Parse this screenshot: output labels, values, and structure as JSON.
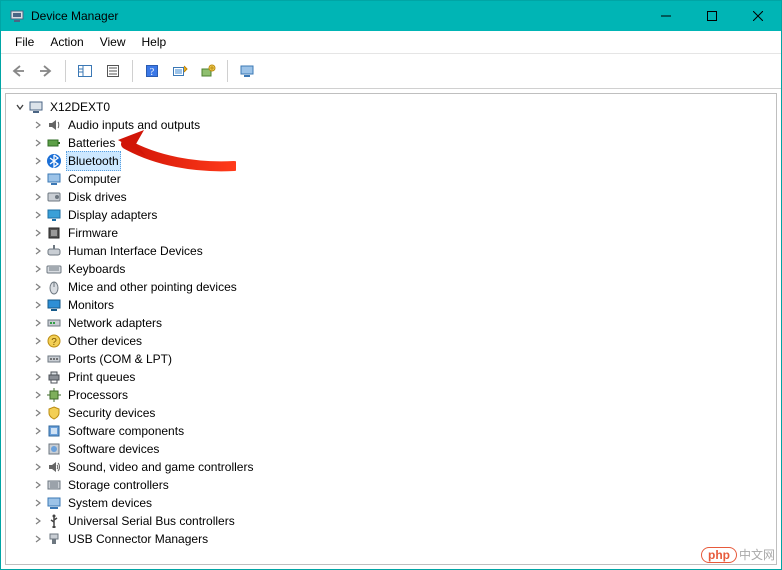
{
  "window": {
    "title": "Device Manager"
  },
  "menubar": {
    "items": [
      "File",
      "Action",
      "View",
      "Help"
    ]
  },
  "tree": {
    "root": {
      "label": "X12DEXT0",
      "expanded": true
    },
    "children": [
      {
        "label": "Audio inputs and outputs",
        "icon": "audio-icon"
      },
      {
        "label": "Batteries",
        "icon": "battery-icon"
      },
      {
        "label": "Bluetooth",
        "icon": "bluetooth-icon",
        "selected": true
      },
      {
        "label": "Computer",
        "icon": "computer-icon"
      },
      {
        "label": "Disk drives",
        "icon": "disk-icon"
      },
      {
        "label": "Display adapters",
        "icon": "display-icon"
      },
      {
        "label": "Firmware",
        "icon": "firmware-icon"
      },
      {
        "label": "Human Interface Devices",
        "icon": "hid-icon"
      },
      {
        "label": "Keyboards",
        "icon": "keyboard-icon"
      },
      {
        "label": "Mice and other pointing devices",
        "icon": "mouse-icon"
      },
      {
        "label": "Monitors",
        "icon": "monitor-icon"
      },
      {
        "label": "Network adapters",
        "icon": "network-icon"
      },
      {
        "label": "Other devices",
        "icon": "other-icon"
      },
      {
        "label": "Ports (COM & LPT)",
        "icon": "ports-icon"
      },
      {
        "label": "Print queues",
        "icon": "printer-icon"
      },
      {
        "label": "Processors",
        "icon": "cpu-icon"
      },
      {
        "label": "Security devices",
        "icon": "security-icon"
      },
      {
        "label": "Software components",
        "icon": "sw-component-icon"
      },
      {
        "label": "Software devices",
        "icon": "sw-device-icon"
      },
      {
        "label": "Sound, video and game controllers",
        "icon": "sound-icon"
      },
      {
        "label": "Storage controllers",
        "icon": "storage-icon"
      },
      {
        "label": "System devices",
        "icon": "system-icon"
      },
      {
        "label": "Universal Serial Bus controllers",
        "icon": "usb-icon"
      },
      {
        "label": "USB Connector Managers",
        "icon": "usb-connector-icon"
      }
    ]
  },
  "watermark": {
    "bubble": "php",
    "text": "中文网"
  },
  "colors": {
    "titlebar": "#00b5b5",
    "selection": "#cde8ff",
    "arrow": "#d11507"
  }
}
